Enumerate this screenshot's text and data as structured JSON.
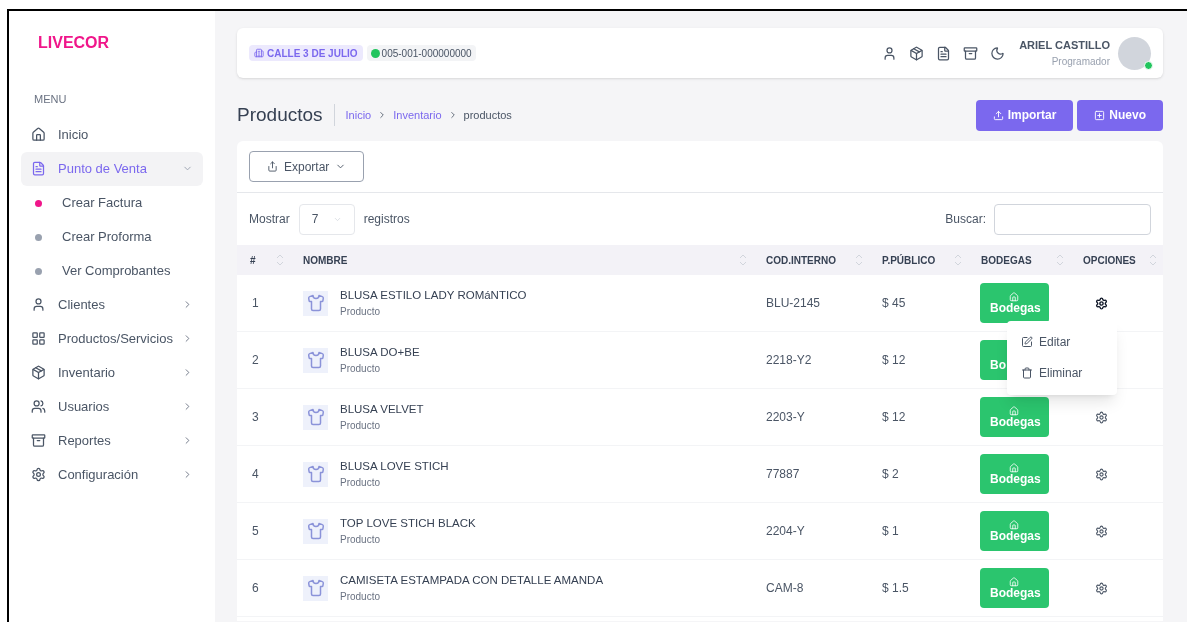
{
  "brand": "LIVECOR",
  "sidebar": {
    "section": "MENU",
    "items": [
      {
        "label": "Inicio",
        "selected": false
      },
      {
        "label": "Punto de Venta",
        "selected": true,
        "expanded": true,
        "children": [
          {
            "label": "Crear Factura",
            "selected": true
          },
          {
            "label": "Crear Proforma",
            "selected": false
          },
          {
            "label": "Ver Comprobantes",
            "selected": false
          }
        ]
      },
      {
        "label": "Clientes",
        "selected": false,
        "expanded": false
      },
      {
        "label": "Productos/Servicios",
        "selected": false,
        "expanded": false
      },
      {
        "label": "Inventario",
        "selected": false,
        "expanded": false
      },
      {
        "label": "Usuarios",
        "selected": false,
        "expanded": false
      },
      {
        "label": "Reportes",
        "selected": false,
        "expanded": false
      },
      {
        "label": "Configuración",
        "selected": false,
        "expanded": false
      }
    ]
  },
  "topbar": {
    "branch": "CALLE 3 DE JULIO",
    "point": "005-001-000000000",
    "user_name": "ARIEL CASTILLO",
    "user_role": "Programador",
    "online": true
  },
  "page": {
    "title": "Productos",
    "breadcrumb": [
      "Inicio",
      "Inventario",
      "productos"
    ],
    "buttons": [
      "Importar",
      "Nuevo"
    ]
  },
  "table": {
    "export_label": "Exportar",
    "show_label": "Mostrar",
    "page_size": "7",
    "records_label": "registros",
    "search_label": "Buscar:",
    "columns": [
      "#",
      "NOMBRE",
      "COD.INTERNO",
      "P.PÚBLICO",
      "BODEGAS",
      "OPCIONES"
    ],
    "rows": [
      {
        "index": "1",
        "name": "BLUSA ESTILO LADY ROMáNTICO",
        "type": "Producto",
        "code": "BLU-2145",
        "price": "$ 45",
        "stock_button": "Bodegas",
        "menu_open": true
      },
      {
        "index": "2",
        "name": "BLUSA DO+BE",
        "type": "Producto",
        "code": "2218-Y2",
        "price": "$ 12",
        "stock_button": "Bo",
        "menu_open": false
      },
      {
        "index": "3",
        "name": "BLUSA VELVET",
        "type": "Producto",
        "code": "2203-Y",
        "price": "$ 12",
        "stock_button": "Bodegas",
        "menu_open": false
      },
      {
        "index": "4",
        "name": "BLUSA LOVE STICH",
        "type": "Producto",
        "code": "77887",
        "price": "$ 2",
        "stock_button": "Bodegas",
        "menu_open": false
      },
      {
        "index": "5",
        "name": "TOP LOVE STICH BLACK",
        "type": "Producto",
        "code": "2204-Y",
        "price": "$ 1",
        "stock_button": "Bodegas",
        "menu_open": false
      },
      {
        "index": "6",
        "name": "CAMISETA ESTAMPADA CON DETALLE AMANDA",
        "type": "Producto",
        "code": "CAM-8",
        "price": "$ 1.5",
        "stock_button": "Bodegas",
        "menu_open": false
      }
    ],
    "row_menu": [
      "Editar",
      "Eliminar"
    ]
  }
}
